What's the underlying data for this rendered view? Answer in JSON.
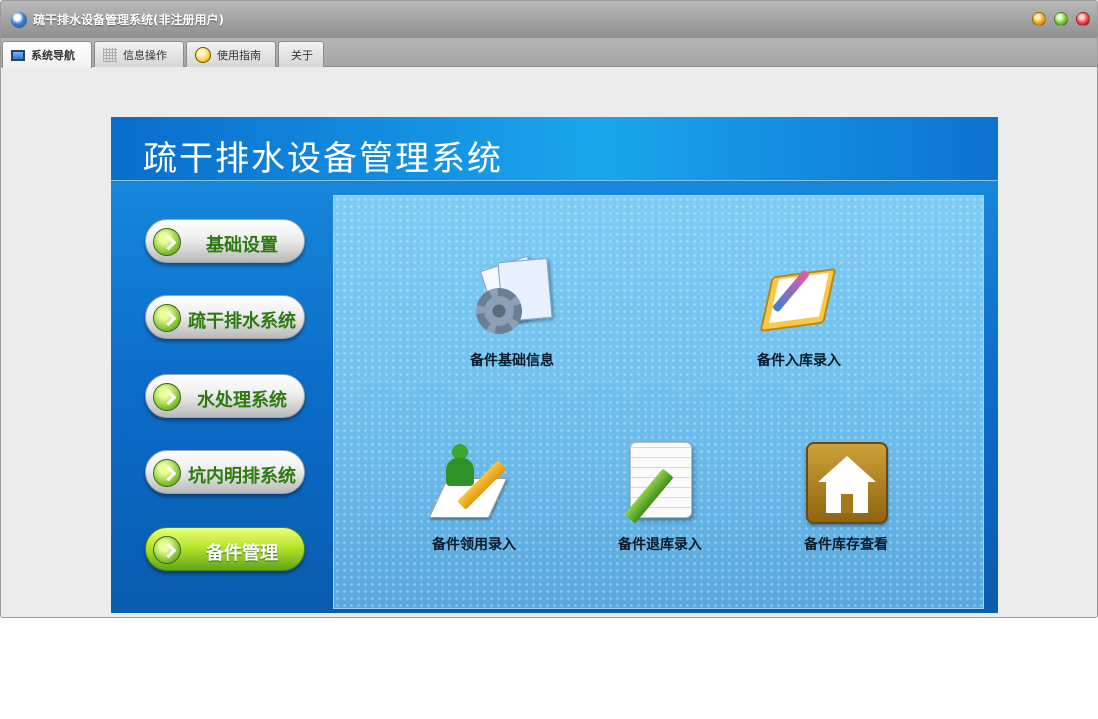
{
  "window": {
    "title": "疏干排水设备管理系统(非注册用户)"
  },
  "tabs": [
    {
      "label": "系统导航",
      "icon": "monitor-icon",
      "active": true
    },
    {
      "label": "信息操作",
      "icon": "grid-icon",
      "active": false
    },
    {
      "label": "使用指南",
      "icon": "lightbulb-icon",
      "active": false
    },
    {
      "label": "关于",
      "icon": "",
      "active": false
    }
  ],
  "banner": {
    "title": "疏干排水设备管理系统"
  },
  "menu": [
    {
      "label": "基础设置",
      "selected": false
    },
    {
      "label": "疏干排水系统",
      "selected": false
    },
    {
      "label": "水处理系统",
      "selected": false
    },
    {
      "label": "坑内明排系统",
      "selected": false
    },
    {
      "label": "备件管理",
      "selected": true
    }
  ],
  "functions": [
    {
      "label": "备件基础信息",
      "icon": "documents-gear-icon"
    },
    {
      "label": "备件入库录入",
      "icon": "clipboard-pen-icon"
    },
    {
      "label": "备件领用录入",
      "icon": "person-pencil-icon"
    },
    {
      "label": "备件退库录入",
      "icon": "notepad-pencil-icon"
    },
    {
      "label": "备件库存查看",
      "icon": "house-icon"
    }
  ],
  "colors": {
    "accent": "#0b6cc8",
    "selected_menu": "#9fd42a"
  }
}
